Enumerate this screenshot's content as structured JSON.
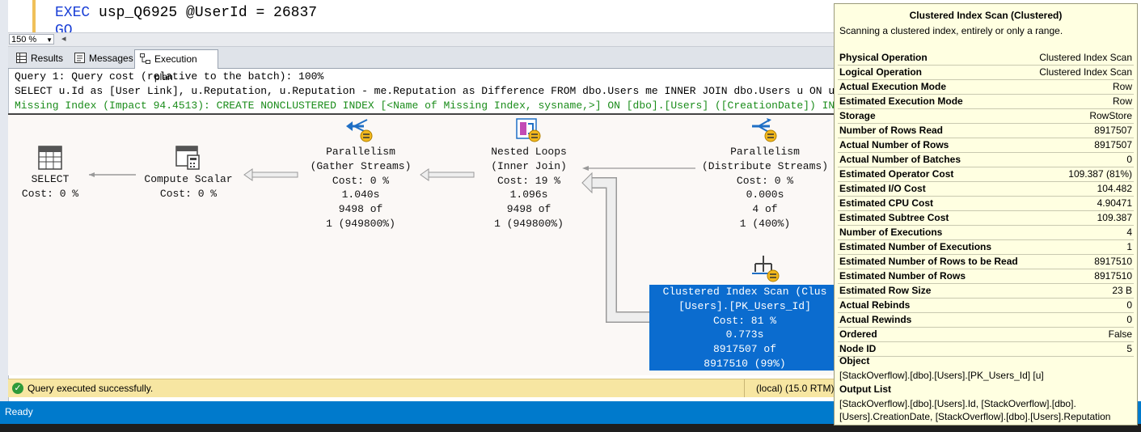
{
  "editor": {
    "line1_keyword": "EXEC",
    "line1_rest": " usp_Q6925 @UserId = 26837",
    "line2": "GO"
  },
  "zoom": {
    "value": "150 %"
  },
  "tabs": [
    {
      "label": "Results",
      "icon": "grid-icon"
    },
    {
      "label": "Messages",
      "icon": "messages-icon"
    },
    {
      "label": "Execution plan",
      "icon": "plan-icon"
    }
  ],
  "query": {
    "header": "Query 1: Query cost (relative to the batch): 100%",
    "sql": "SELECT u.Id as [User Link], u.Reputation, u.Reputation - me.Reputation as Difference FROM dbo.Users me INNER JOIN dbo.Users u ON u.",
    "missing_index": "Missing Index (Impact 94.4513): CREATE NONCLUSTERED INDEX [<Name of Missing Index, sysname,>] ON [dbo].[Users] ([CreationDate]) INCLUDE"
  },
  "plan": {
    "select": {
      "name": "SELECT",
      "cost": "Cost: 0 %"
    },
    "compute_scalar": {
      "name": "Compute Scalar",
      "cost": "Cost: 0 %"
    },
    "gather": {
      "name": "Parallelism",
      "sub": "(Gather Streams)",
      "cost": "Cost: 0 %",
      "time": "1.040s",
      "rows": "9498 of",
      "est": "1 (949800%)"
    },
    "nested_loops": {
      "name": "Nested Loops",
      "sub": "(Inner Join)",
      "cost": "Cost: 19 %",
      "time": "1.096s",
      "rows": "9498 of",
      "est": "1 (949800%)"
    },
    "distribute": {
      "name": "Parallelism",
      "sub": "(Distribute Streams)",
      "cost": "Cost: 0 %",
      "time": "0.000s",
      "rows": "4 of",
      "est": "1 (400%)"
    },
    "scan": {
      "name": "Clustered Index Scan (Clus",
      "object": "[Users].[PK_Users_Id]",
      "cost": "Cost: 81 %",
      "time": "0.773s",
      "rows": "8917507 of",
      "est": "8917510 (99%)"
    }
  },
  "status": {
    "message": "Query executed successfully.",
    "server": "(local) (15.0 RTM)",
    "ready": "Ready"
  },
  "tooltip": {
    "title": "Clustered Index Scan (Clustered)",
    "description": "Scanning a clustered index, entirely or only a range.",
    "properties": [
      {
        "k": "Physical Operation",
        "v": "Clustered Index Scan"
      },
      {
        "k": "Logical Operation",
        "v": "Clustered Index Scan"
      },
      {
        "k": "Actual Execution Mode",
        "v": "Row"
      },
      {
        "k": "Estimated Execution Mode",
        "v": "Row"
      },
      {
        "k": "Storage",
        "v": "RowStore"
      },
      {
        "k": "Number of Rows Read",
        "v": "8917507"
      },
      {
        "k": "Actual Number of Rows",
        "v": "8917507"
      },
      {
        "k": "Actual Number of Batches",
        "v": "0"
      },
      {
        "k": "Estimated Operator Cost",
        "v": "109.387 (81%)"
      },
      {
        "k": "Estimated I/O Cost",
        "v": "104.482"
      },
      {
        "k": "Estimated CPU Cost",
        "v": "4.90471"
      },
      {
        "k": "Estimated Subtree Cost",
        "v": "109.387"
      },
      {
        "k": "Number of Executions",
        "v": "4"
      },
      {
        "k": "Estimated Number of Executions",
        "v": "1"
      },
      {
        "k": "Estimated Number of Rows to be Read",
        "v": "8917510"
      },
      {
        "k": "Estimated Number of Rows",
        "v": "8917510"
      },
      {
        "k": "Estimated Row Size",
        "v": "23 B"
      },
      {
        "k": "Actual Rebinds",
        "v": "0"
      },
      {
        "k": "Actual Rewinds",
        "v": "0"
      },
      {
        "k": "Ordered",
        "v": "False"
      },
      {
        "k": "Node ID",
        "v": "5"
      }
    ],
    "object_header": "Object",
    "object_value": "[StackOverflow].[dbo].[Users].[PK_Users_Id] [u]",
    "output_header": "Output List",
    "output_line1": "[StackOverflow].[dbo].[Users].Id, [StackOverflow].[dbo].",
    "output_line2": "[Users].CreationDate, [StackOverflow].[dbo].[Users].Reputation"
  }
}
